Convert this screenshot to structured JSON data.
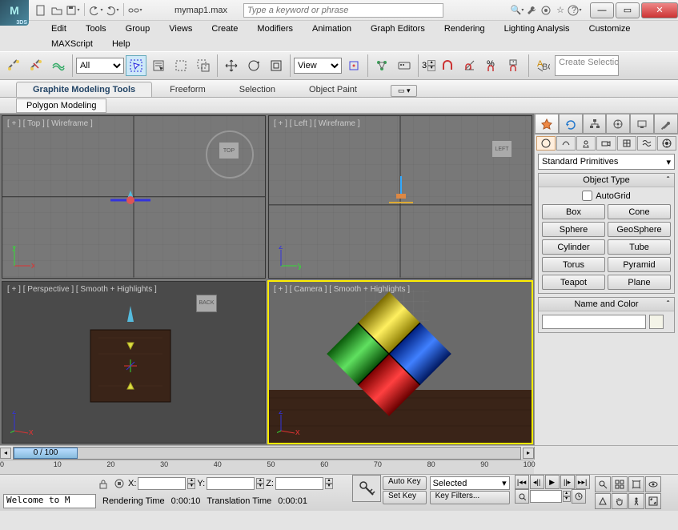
{
  "app": {
    "title": "mymap1.max",
    "logo_sub": "3DS"
  },
  "search": {
    "placeholder": "Type a keyword or phrase"
  },
  "menu": [
    "Edit",
    "Tools",
    "Group",
    "Views",
    "Create",
    "Modifiers",
    "Animation",
    "Graph Editors",
    "Rendering",
    "Lighting Analysis",
    "Customize"
  ],
  "menu2": [
    "MAXScript",
    "Help"
  ],
  "toolbar": {
    "selection_filter": "All",
    "ref_coord": "View",
    "angle": "3",
    "create_selection": "Create Selection"
  },
  "ribbon": {
    "tabs": [
      "Graphite Modeling Tools",
      "Freeform",
      "Selection",
      "Object Paint"
    ],
    "subtab": "Polygon Modeling"
  },
  "viewports": {
    "tl": "[ + ] [ Top ] [ Wireframe ]",
    "tr": "[ + ] [ Left ] [ Wireframe ]",
    "bl": "[ + ] [ Perspective ] [ Smooth + Highlights ]",
    "br": "[ + ] [ Camera ] [ Smooth + Highlights ]",
    "cube_top": "TOP",
    "cube_left": "LEFT",
    "cube_back": "BACK"
  },
  "cmdpanel": {
    "dropdown": "Standard Primitives",
    "rollout_objtype": "Object Type",
    "autogrid": "AutoGrid",
    "buttons": [
      "Box",
      "Cone",
      "Sphere",
      "GeoSphere",
      "Cylinder",
      "Tube",
      "Torus",
      "Pyramid",
      "Teapot",
      "Plane"
    ],
    "rollout_name": "Name and Color"
  },
  "timeslider": {
    "label": "0 / 100"
  },
  "ruler": {
    "ticks": [
      "0",
      "10",
      "20",
      "30",
      "40",
      "50",
      "60",
      "70",
      "80",
      "90",
      "100"
    ]
  },
  "status": {
    "x": "X:",
    "y": "Y:",
    "z": "Z:",
    "welcome": "Welcome to M",
    "render_time_label": "Rendering Time",
    "render_time": "0:00:10",
    "trans_time_label": "Translation Time",
    "trans_time": "0:00:01",
    "autokey": "Auto Key",
    "setkey": "Set Key",
    "selected": "Selected",
    "keyfilters": "Key Filters..."
  }
}
